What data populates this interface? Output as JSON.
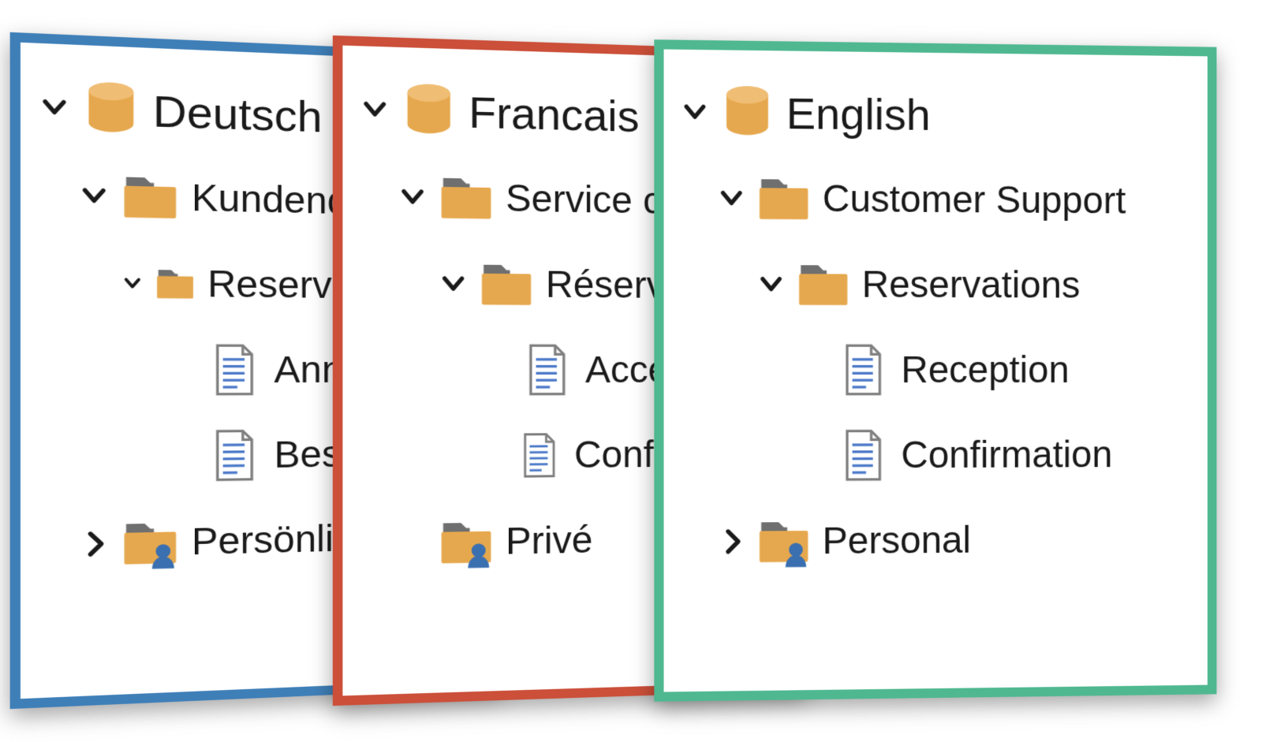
{
  "colors": {
    "blue": "#3f7fb8",
    "red": "#cb4f39",
    "green": "#4fb890",
    "folder_fill": "#e6a84e",
    "folder_tab": "#6f6f6f",
    "doc_stroke": "#808080",
    "doc_line": "#4a78c8",
    "db_fill": "#e6a84e",
    "chev": "#1a1a1a",
    "person": "#3a6fb0"
  },
  "panes": [
    {
      "id": "de",
      "color": "blue",
      "items": [
        {
          "lvl": 0,
          "icon": "db",
          "chev": "down",
          "label": "Deutsch"
        },
        {
          "lvl": 1,
          "icon": "folder",
          "chev": "down",
          "label": "Kundendienst"
        },
        {
          "lvl": 2,
          "icon": "folder",
          "chev": "down",
          "label": "Reservierungen"
        },
        {
          "lvl": 3,
          "icon": "doc",
          "chev": "none",
          "label": "Annahme"
        },
        {
          "lvl": 3,
          "icon": "doc",
          "chev": "none",
          "label": "Bestätigung"
        },
        {
          "lvl": 1,
          "icon": "pfolder",
          "chev": "right",
          "label": "Persönlich"
        }
      ]
    },
    {
      "id": "fr",
      "color": "red",
      "items": [
        {
          "lvl": 0,
          "icon": "db",
          "chev": "down",
          "label": "Francais"
        },
        {
          "lvl": 1,
          "icon": "folder",
          "chev": "down",
          "label": "Service clientèle"
        },
        {
          "lvl": 2,
          "icon": "folder",
          "chev": "down",
          "label": "Réservations"
        },
        {
          "lvl": 3,
          "icon": "doc",
          "chev": "none",
          "label": "Acceptation"
        },
        {
          "lvl": 3,
          "icon": "doc",
          "chev": "none",
          "label": "Confirmation"
        },
        {
          "lvl": 1,
          "icon": "pfolder",
          "chev": "none",
          "label": "Privé"
        }
      ]
    },
    {
      "id": "en",
      "color": "green",
      "items": [
        {
          "lvl": 0,
          "icon": "db",
          "chev": "down",
          "label": "English"
        },
        {
          "lvl": 1,
          "icon": "folder",
          "chev": "down",
          "label": "Customer Support"
        },
        {
          "lvl": 2,
          "icon": "folder",
          "chev": "down",
          "label": "Reservations"
        },
        {
          "lvl": 3,
          "icon": "doc",
          "chev": "none",
          "label": "Reception"
        },
        {
          "lvl": 3,
          "icon": "doc",
          "chev": "none",
          "label": "Confirmation"
        },
        {
          "lvl": 1,
          "icon": "pfolder",
          "chev": "right",
          "label": "Personal"
        }
      ]
    }
  ]
}
